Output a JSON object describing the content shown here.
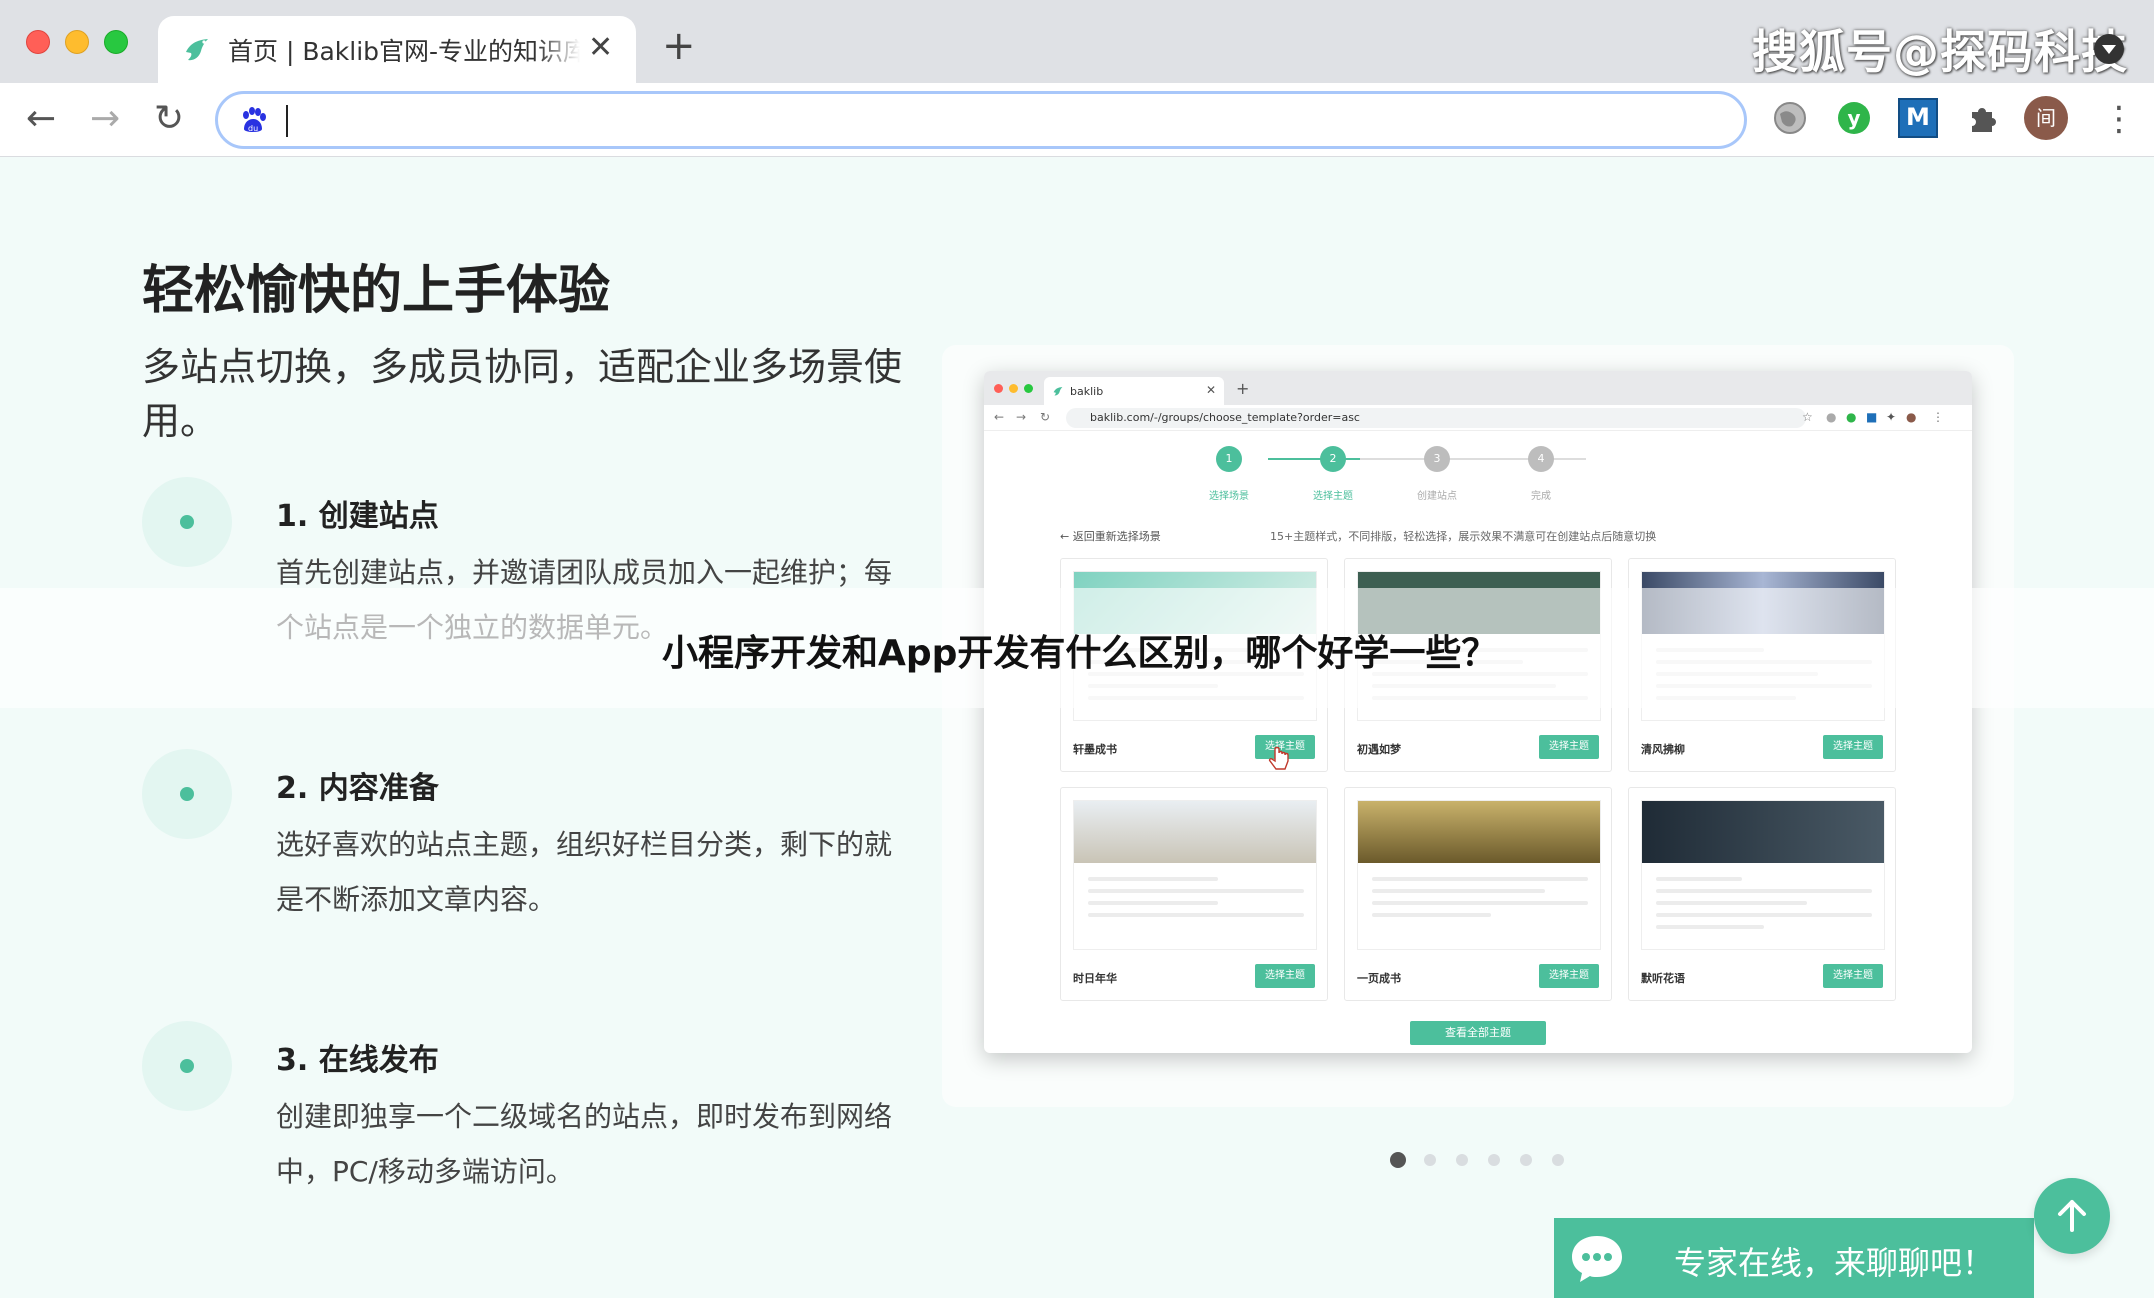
{
  "browser": {
    "tab_title": "首页 | Baklib官网-专业的知识库及在线文档",
    "tab_close": "✕",
    "new_tab": "+",
    "back_icon": "←",
    "forward_icon": "→",
    "reload_icon": "↻",
    "address_value": "",
    "extensions": [
      "globe-icon",
      "green-v-extension-icon",
      "m-extension-icon",
      "puzzle-icon",
      "profile-avatar",
      "kebab-menu-icon"
    ],
    "m_ext_label": "M",
    "v_ext_label": "y",
    "avatar_label": "间",
    "menu_icon": "⋮"
  },
  "watermark": "搜狐号@探码科技",
  "hero": {
    "title": "轻松愉快的上手体验",
    "subtitle": "多站点切换，多成员协同，适配企业多场景使用。"
  },
  "steps": [
    {
      "title": "1. 创建站点",
      "desc": "首先创建站点，并邀请团队成员加入一起维护；每个站点是一个独立的数据单元。"
    },
    {
      "title": "2. 内容准备",
      "desc": "选好喜欢的站点主题，组织好栏目分类，剩下的就是不断添加文章内容。"
    },
    {
      "title": "3. 在线发布",
      "desc": "创建即独享一个二级域名的站点，即时发布到网络中，PC/移动多端访问。"
    }
  ],
  "preview": {
    "tab_title": "baklib",
    "url": "baklib.com/-/groups/choose_template?order=asc",
    "steps": [
      {
        "num": "1",
        "label": "选择场景"
      },
      {
        "num": "2",
        "label": "选择主题"
      },
      {
        "num": "3",
        "label": "创建站点"
      },
      {
        "num": "4",
        "label": "完成"
      }
    ],
    "back_link": "← 返回重新选择场景",
    "hint": "15+主题样式，不同排版，轻松选择，展示效果不满意可在创建站点后随意切换",
    "templates": [
      {
        "name": "轩墨成书",
        "btn": "选择主题"
      },
      {
        "name": "初遇如梦",
        "btn": "选择主题"
      },
      {
        "name": "清风拂柳",
        "btn": "选择主题"
      },
      {
        "name": "时日年华",
        "btn": "选择主题"
      },
      {
        "name": "一页成书",
        "btn": "选择主题"
      },
      {
        "name": "默听花语",
        "btn": "选择主题"
      }
    ],
    "view_all": "查看全部主题"
  },
  "carousel": {
    "count": 6,
    "active": 0
  },
  "banner": "小程序开发和App开发有什么区别，哪个好学一些？",
  "chat": {
    "label": "专家在线，来聊聊吧！"
  },
  "colors": {
    "accent": "#4cbf9c",
    "page_bg": "#f2fbf9",
    "tabbar_bg": "#dfe1e5"
  }
}
